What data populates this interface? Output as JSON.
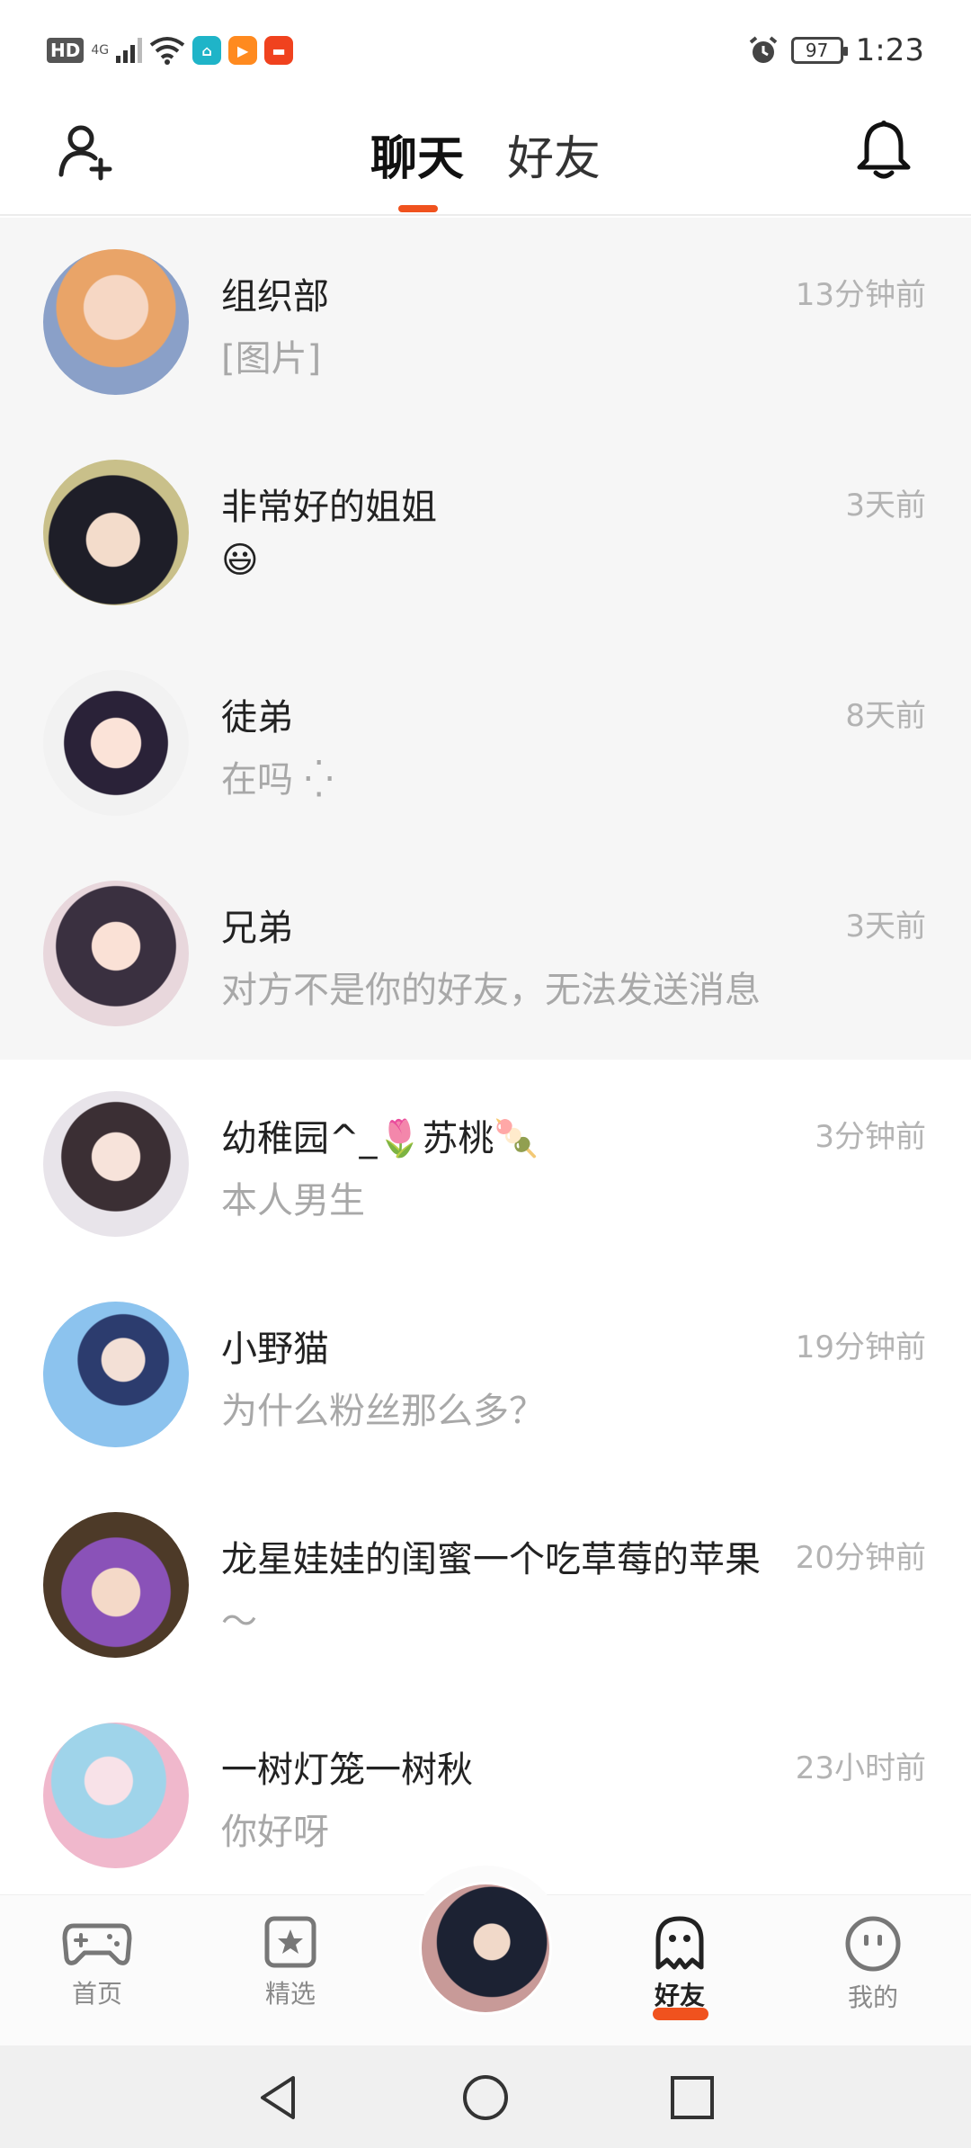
{
  "status_bar": {
    "hd": "HD",
    "signal": "4G",
    "battery": "97",
    "time": "1:23",
    "icons": [
      "wifi-icon",
      "home-app-icon",
      "video-app-icon",
      "shop-app-icon",
      "alarm-icon"
    ]
  },
  "header": {
    "tabs": [
      {
        "label": "聊天",
        "active": true
      },
      {
        "label": "好友",
        "active": false
      }
    ],
    "left_icon": "add-user-icon",
    "right_icon": "bell-icon",
    "accent": "#f0521e"
  },
  "conversations": [
    {
      "name": "组织部",
      "message": "[图片]",
      "time": "13分钟前",
      "pinned": true
    },
    {
      "name": "非常好的姐姐",
      "message": "😃",
      "time": "3天前",
      "pinned": true
    },
    {
      "name": "徒弟",
      "message": "在吗 ⁛",
      "time": "8天前",
      "pinned": true
    },
    {
      "name": "兄弟",
      "message": "对方不是你的好友，无法发送消息",
      "time": "3天前",
      "pinned": true
    },
    {
      "name": "幼稚园^_🌷苏桃🍡",
      "message": "本人男生",
      "time": "3分钟前",
      "pinned": false
    },
    {
      "name": "小野猫",
      "message": "为什么粉丝那么多？",
      "time": "19分钟前",
      "pinned": false
    },
    {
      "name": "龙星娃娃的闺蜜一个吃草莓的苹果",
      "message": "～",
      "time": "20分钟前",
      "pinned": false
    },
    {
      "name": "一树灯笼一树秋",
      "message": "你好呀",
      "time": "23小时前",
      "pinned": false
    }
  ],
  "bottom_nav": {
    "items": [
      {
        "label": "首页",
        "icon": "gamepad-icon"
      },
      {
        "label": "精选",
        "icon": "star-bookmark-icon"
      },
      {
        "label": "好友",
        "icon": "ghost-icon",
        "active": true
      },
      {
        "label": "我的",
        "icon": "smiley-icon"
      }
    ]
  },
  "system_nav": [
    "back-icon",
    "home-icon",
    "recents-icon"
  ]
}
